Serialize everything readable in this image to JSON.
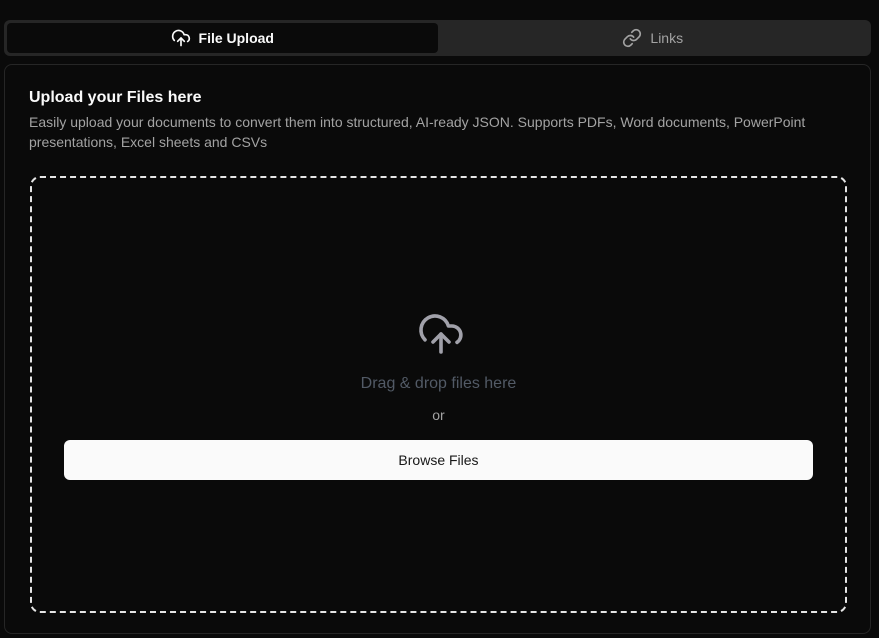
{
  "tabs": [
    {
      "label": "File Upload",
      "icon": "cloud-upload-icon",
      "active": true
    },
    {
      "label": "Links",
      "icon": "link-icon",
      "active": false
    }
  ],
  "card": {
    "title": "Upload your Files here",
    "description": "Easily upload your documents to convert them into structured, AI-ready JSON. Supports PDFs, Word documents, PowerPoint presentations, Excel sheets and CSVs"
  },
  "dropzone": {
    "icon": "cloud-upload-icon",
    "drag_text": "Drag & drop files here",
    "or_text": "or",
    "browse_label": "Browse Files"
  },
  "colors": {
    "background": "#0a0a0a",
    "tab_bar": "#262626",
    "button_bg": "#fafafa",
    "muted_text": "#a3a3a3"
  }
}
